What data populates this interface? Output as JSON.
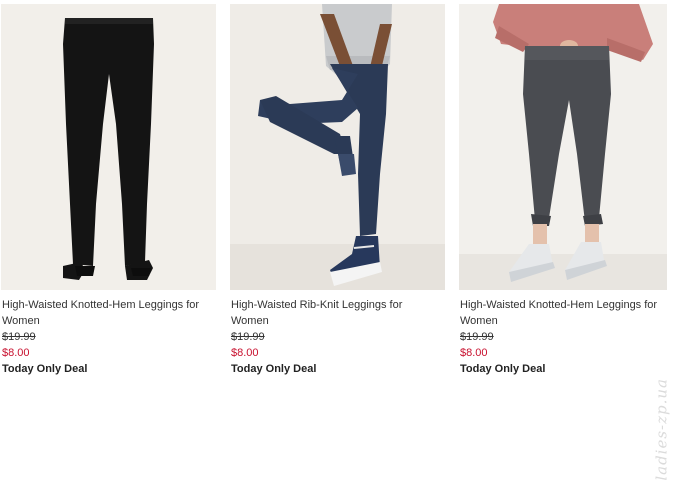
{
  "products": [
    {
      "name": "High-Waisted Knotted-Hem Leggings for Women",
      "original_price": "$19.99",
      "sale_price": "$8.00",
      "deal": "Today Only Deal",
      "image_color": "black"
    },
    {
      "name": "High-Waisted Rib-Knit Leggings for Women",
      "original_price": "$19.99",
      "sale_price": "$8.00",
      "deal": "Today Only Deal",
      "image_color": "navy"
    },
    {
      "name": "High-Waisted Knotted-Hem Leggings for Women",
      "original_price": "$19.99",
      "sale_price": "$8.00",
      "deal": "Today Only Deal",
      "image_color": "charcoal gray"
    }
  ],
  "colors": {
    "text": "#333333",
    "sale_price": "#c8102e",
    "image_bg": "#f1eee9"
  },
  "watermark": "ladies-zp.ua"
}
